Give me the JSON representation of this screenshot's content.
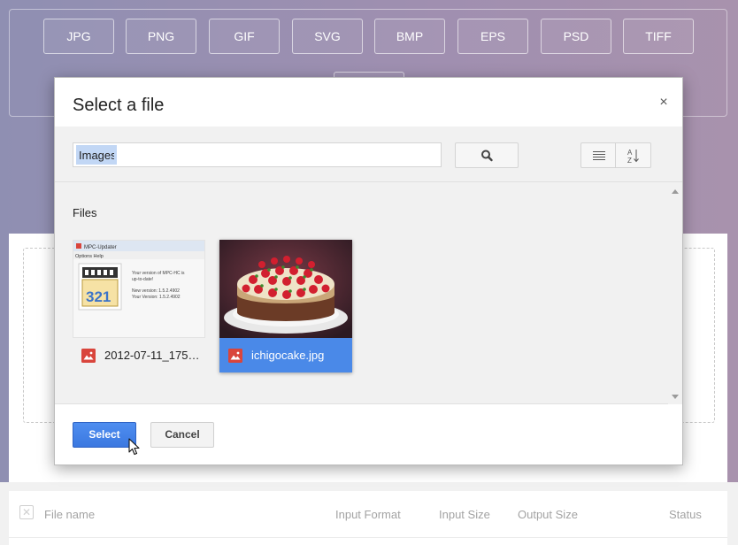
{
  "background": {
    "formats": [
      "JPG",
      "PNG",
      "GIF",
      "SVG",
      "BMP",
      "EPS",
      "PSD",
      "TIFF"
    ],
    "extra_format": "",
    "table_headers": {
      "file_name": "File name",
      "input_format": "Input Format",
      "input_size": "Input Size",
      "output_size": "Output Size",
      "status": "Status"
    },
    "checkbox_glyph": "✕"
  },
  "dialog": {
    "title": "Select a file",
    "close_glyph": "×",
    "search": {
      "value": "Images",
      "placeholder": ""
    },
    "section_label": "Files",
    "files": [
      {
        "name": "2012-07-11_175…",
        "selected": false
      },
      {
        "name": "ichigocake.jpg",
        "selected": true
      }
    ],
    "mpc_thumb": {
      "title": "MPC-Updater",
      "menu": "Options  Help",
      "line1": "Your version of MPC-HC is",
      "line2": "up-to-date!",
      "line3": "New version:  1.5.2.4902",
      "line4": "Your Version:  1.5.2.4902",
      "logo_number": "321"
    },
    "select_label": "Select",
    "cancel_label": "Cancel"
  },
  "colors": {
    "accent": "#4a89e8",
    "image_icon": "#d9453c"
  },
  "icons": {
    "search": "search-icon",
    "list_view": "list-view-icon",
    "sort": "sort-az-icon",
    "image_file": "image-file-icon",
    "cursor": "mouse-pointer-icon"
  }
}
